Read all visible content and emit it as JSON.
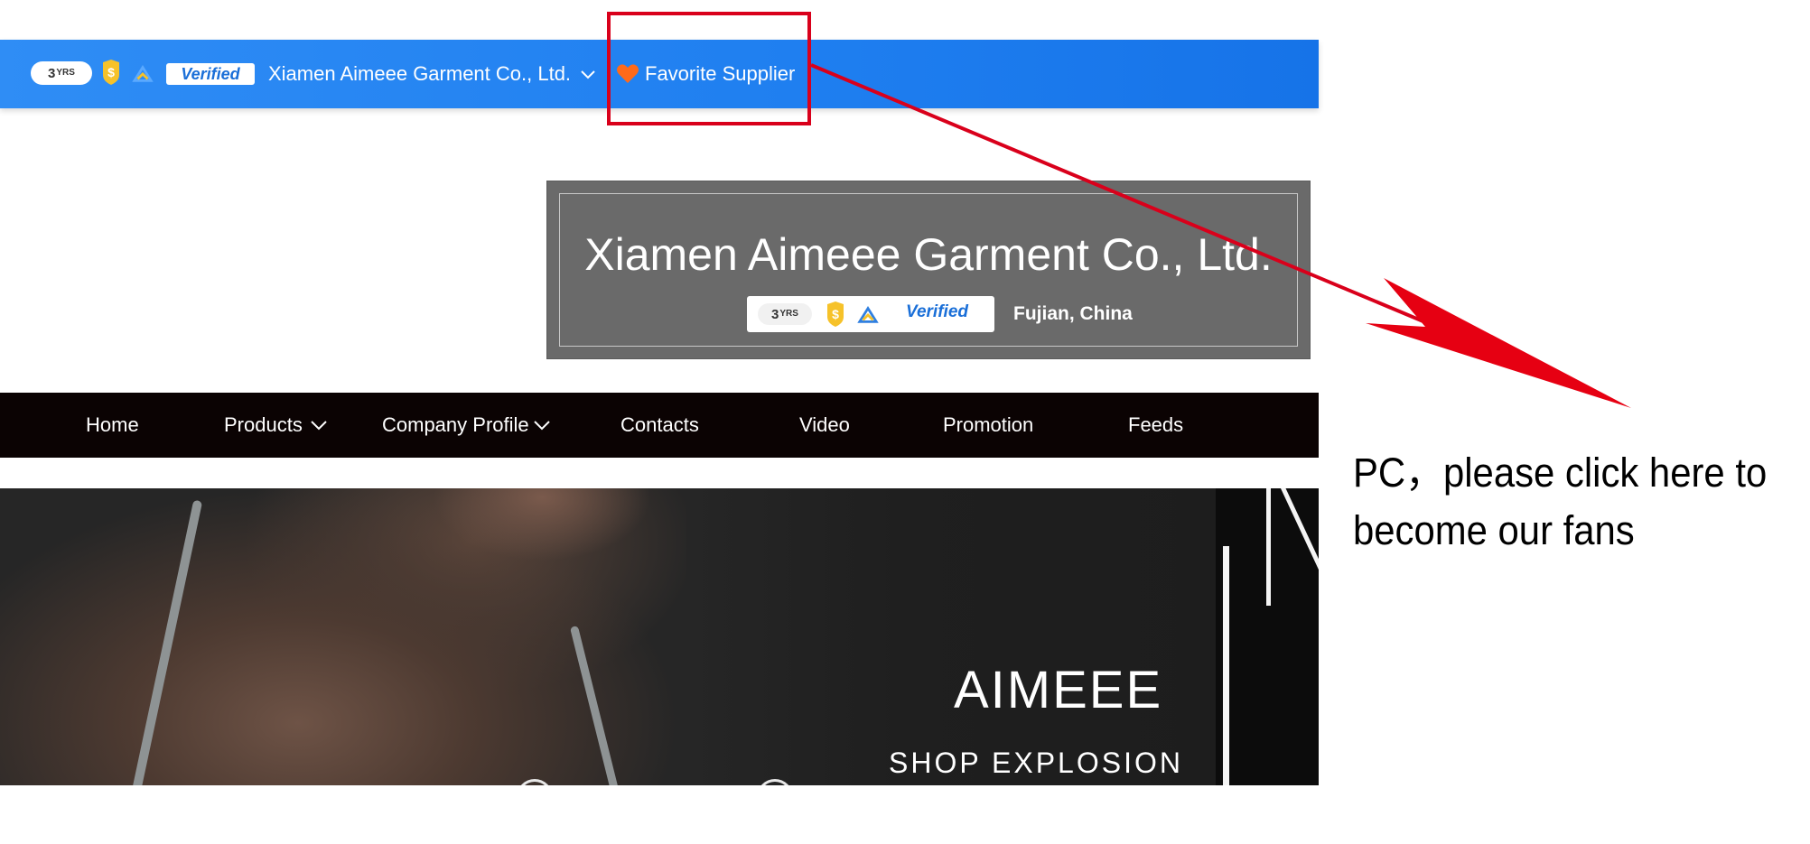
{
  "topbar": {
    "years_number": "3",
    "years_suffix": "YRS",
    "verified_label": "Verified",
    "company_name": "Xiamen Aimeee Garment Co., Ltd.",
    "favorite_label": "Favorite Supplier"
  },
  "banner": {
    "company_name": "Xiamen Aimeee Garment Co., Ltd.",
    "years_number": "3",
    "years_suffix": "YRS",
    "verified_label": "Verified",
    "location": "Fujian, China"
  },
  "nav": {
    "items": [
      {
        "label": "Home"
      },
      {
        "label": "Products"
      },
      {
        "label": "Company Profile"
      },
      {
        "label": "Contacts"
      },
      {
        "label": "Video"
      },
      {
        "label": "Promotion"
      },
      {
        "label": "Feeds"
      }
    ]
  },
  "hero": {
    "brand": "AIMEEE",
    "subtitle": "SHOP EXPLOSION"
  },
  "annotation": {
    "line1": "PC，please click here to",
    "line2": "become our fans"
  },
  "colors": {
    "topbar_blue": "#1f7ff0",
    "annotation_red": "#d9001b",
    "nav_background": "#0b0303",
    "banner_gray": "#6a6a6a",
    "verified_blue": "#1a6fd8",
    "heart_orange": "#ff6a1a"
  },
  "icons": [
    "gold-supplier-medal-icon",
    "trade-assurance-icon",
    "chevron-down-icon",
    "heart-icon",
    "annotation-arrow-icon"
  ]
}
